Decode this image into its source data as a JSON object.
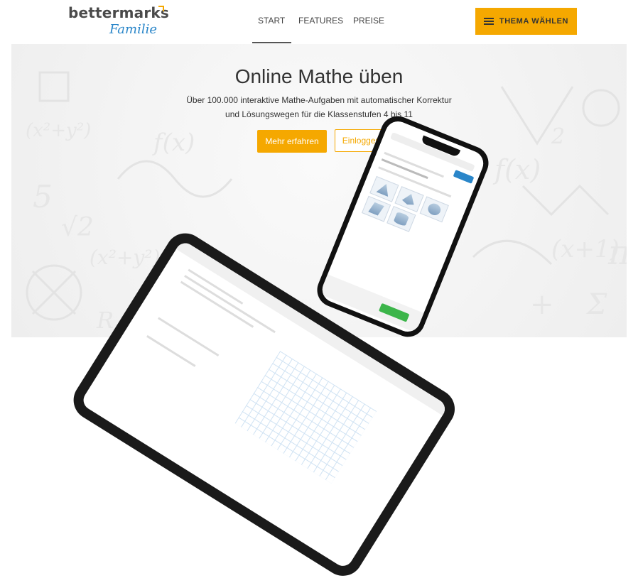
{
  "header": {
    "logo_main": "bettermarks",
    "logo_sub": "Familie",
    "nav": [
      {
        "label": "START",
        "active": true
      },
      {
        "label": "FEATURES",
        "active": false
      },
      {
        "label": "PREISE",
        "active": false
      }
    ],
    "topic_button": {
      "label": "THEMA WÄHLEN",
      "icon": "hamburger-menu-icon"
    }
  },
  "hero": {
    "title": "Online Mathe üben",
    "subtitle_line1": "Über 100.000 interaktive Mathe-Aufgaben mit automatischer Korrektur",
    "subtitle_line2": "und Lösungswegen für die Klassenstufen 4 bis 11",
    "primary_button": "Mehr erfahren",
    "secondary_button": "Einloggen"
  },
  "colors": {
    "accent": "#f5a800",
    "brand_blue": "#2a86c9",
    "text": "#333333"
  }
}
